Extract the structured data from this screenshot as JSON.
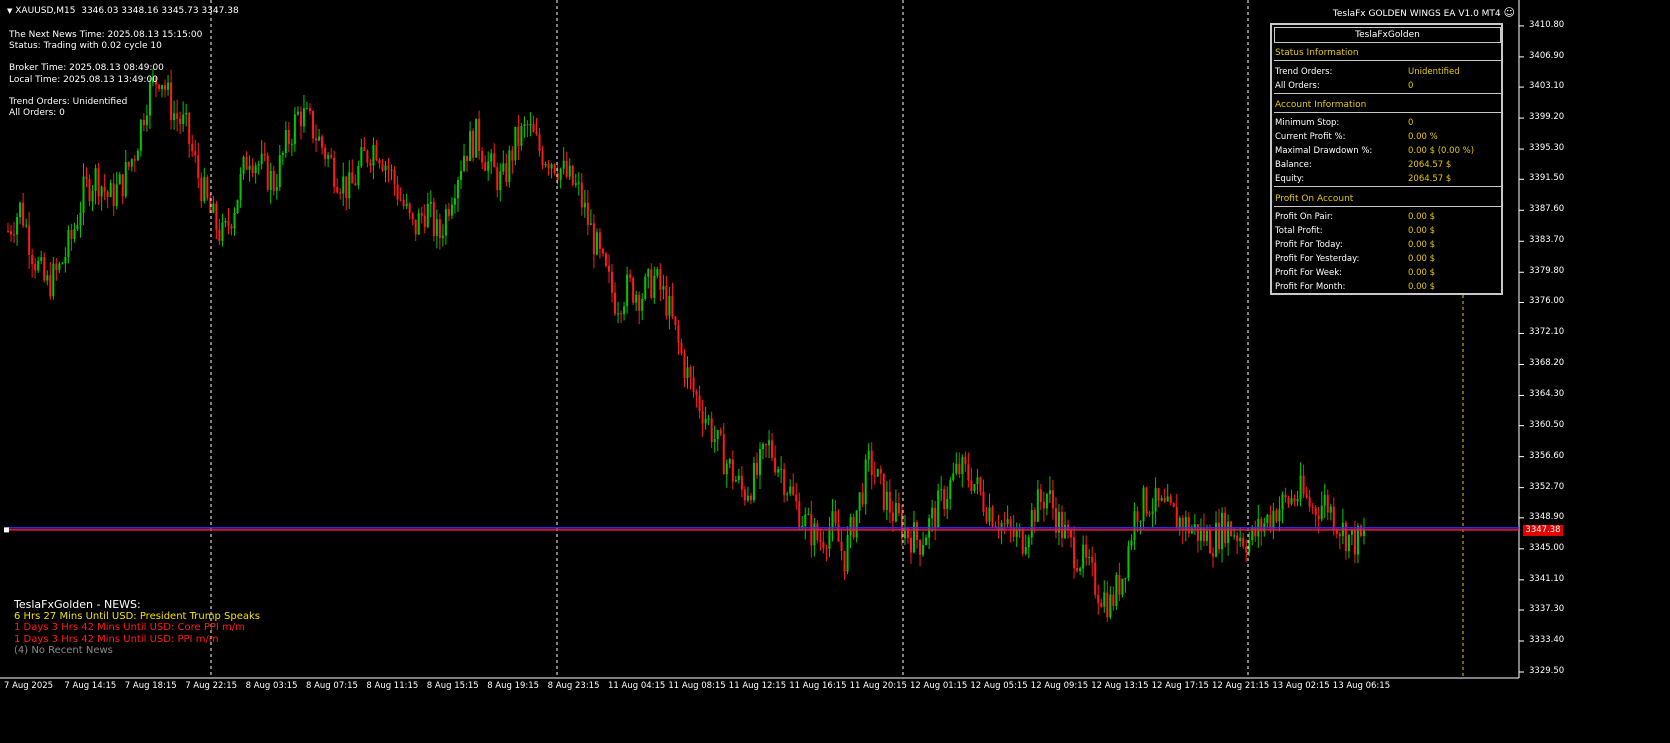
{
  "symbol_header": {
    "arrow": "▼",
    "symbol": "XAUUSD,M15",
    "ohlc": "3346.03 3348.16 3345.73 3347.38"
  },
  "ea": {
    "name": "TeslaFx GOLDEN WINGS EA",
    "version": "V1.0 MT4",
    "smiley_icon": "☺"
  },
  "info": {
    "news_time": "The Next News Time: 2025.08.13 15:15:00",
    "status": "Status: Trading with 0.02 cycle 10",
    "broker_time": "Broker Time: 2025.08.13 08:49:00",
    "local_time": "Local Time: 2025.08.13 13:49:00",
    "trend_orders": "Trend Orders: Unidentified",
    "all_orders": "All Orders: 0"
  },
  "panel": {
    "title": "TeslaFxGolden",
    "status_section": "Status Information",
    "status_rows": [
      {
        "label": "Trend Orders:",
        "value": "Unidentified"
      },
      {
        "label": "All Orders:",
        "value": "0"
      }
    ],
    "account_section": "Account Information",
    "account_rows": [
      {
        "label": "Minimum Stop:",
        "value": "0"
      },
      {
        "label": "Current Profit %:",
        "value": "0.00 %"
      },
      {
        "label": "Maximal Drawdown %:",
        "value": "0.00 $ (0.00 %)"
      },
      {
        "label": "Balance:",
        "value": "2064.57 $"
      },
      {
        "label": "Equity:",
        "value": "2064.57 $"
      }
    ],
    "profit_section": "Profit On Account",
    "profit_rows": [
      {
        "label": "Profit On Pair:",
        "value": "0.00 $"
      },
      {
        "label": "Total Profit:",
        "value": "0.00 $"
      },
      {
        "label": "Profit For Today:",
        "value": "0.00 $"
      },
      {
        "label": "Profit For Yesterday:",
        "value": "0.00 $"
      },
      {
        "label": "Profit For Week:",
        "value": "0.00 $"
      },
      {
        "label": "Profit For Month:",
        "value": "0.00 $"
      }
    ]
  },
  "news": {
    "header": "TeslaFxGolden - NEWS:",
    "items": [
      {
        "text": "6 Hrs 27 Mins Until USD: President Trump Speaks",
        "color": "#f0e000"
      },
      {
        "text": "1 Days 3 Hrs 42 Mins Until USD: Core PPI m/m",
        "color": "#ff1a1a"
      },
      {
        "text": "1 Days 3 Hrs 42 Mins Until USD: PPI m/m",
        "color": "#ff1a1a"
      },
      {
        "text": "(4)  No Recent News",
        "color": "#8a8a8a"
      }
    ]
  },
  "price_axis": {
    "labels": [
      "3410.80",
      "3406.90",
      "3403.10",
      "3399.20",
      "3395.30",
      "3391.50",
      "3387.60",
      "3383.70",
      "3379.80",
      "3376.00",
      "3372.10",
      "3368.20",
      "3364.30",
      "3360.50",
      "3356.60",
      "3352.70",
      "3348.90",
      "3345.00",
      "3341.10",
      "3337.30",
      "3333.40",
      "3329.50"
    ],
    "current_price": "3347.38",
    "bid_price": 3347.38
  },
  "time_axis": {
    "labels": [
      "7 Aug 2025",
      "7 Aug 14:15",
      "7 Aug 18:15",
      "7 Aug 22:15",
      "8 Aug 03:15",
      "8 Aug 07:15",
      "8 Aug 11:15",
      "8 Aug 15:15",
      "8 Aug 19:15",
      "8 Aug 23:15",
      "11 Aug 04:15",
      "11 Aug 08:15",
      "11 Aug 12:15",
      "11 Aug 16:15",
      "11 Aug 20:15",
      "12 Aug 01:15",
      "12 Aug 05:15",
      "12 Aug 09:15",
      "12 Aug 13:15",
      "12 Aug 17:15",
      "12 Aug 21:15",
      "13 Aug 02:15",
      "13 Aug 06:15"
    ]
  },
  "chart_data": {
    "type": "candlestick",
    "symbol": "XAUUSD",
    "timeframe": "M15",
    "ylim": [
      3329.5,
      3412.8
    ],
    "up_color": "#00c800",
    "down_color": "#ff1a1a",
    "bid_line_color": "#ff1a1a",
    "ask_line_color": "#3030ff",
    "period_separator_color": "#ffffff",
    "future_separator_color": "#e6c800",
    "trend_path": [
      3385,
      3388,
      3382,
      3378,
      3380,
      3384,
      3390,
      3392,
      3389,
      3391,
      3395,
      3402,
      3405,
      3400,
      3398,
      3392,
      3387,
      3384,
      3389,
      3395,
      3393,
      3391,
      3396,
      3400,
      3398,
      3395,
      3392,
      3390,
      3394,
      3396,
      3393,
      3389,
      3385,
      3388,
      3384,
      3390,
      3395,
      3397,
      3393,
      3391,
      3396,
      3398,
      3395,
      3394,
      3392,
      3390,
      3385,
      3380,
      3376,
      3378,
      3377,
      3379,
      3376,
      3370,
      3365,
      3362,
      3358,
      3355,
      3352,
      3354,
      3358,
      3355,
      3351,
      3348,
      3346,
      3348,
      3344,
      3350,
      3356,
      3352,
      3349,
      3347,
      3346,
      3349,
      3352,
      3355,
      3354,
      3351,
      3349,
      3347,
      3346,
      3350,
      3352,
      3348,
      3345,
      3343,
      3340,
      3338,
      3342,
      3350,
      3351,
      3350,
      3349,
      3348,
      3347,
      3346,
      3348,
      3347,
      3346,
      3348,
      3350,
      3351,
      3352,
      3350,
      3351,
      3348,
      3346,
      3346
    ]
  }
}
